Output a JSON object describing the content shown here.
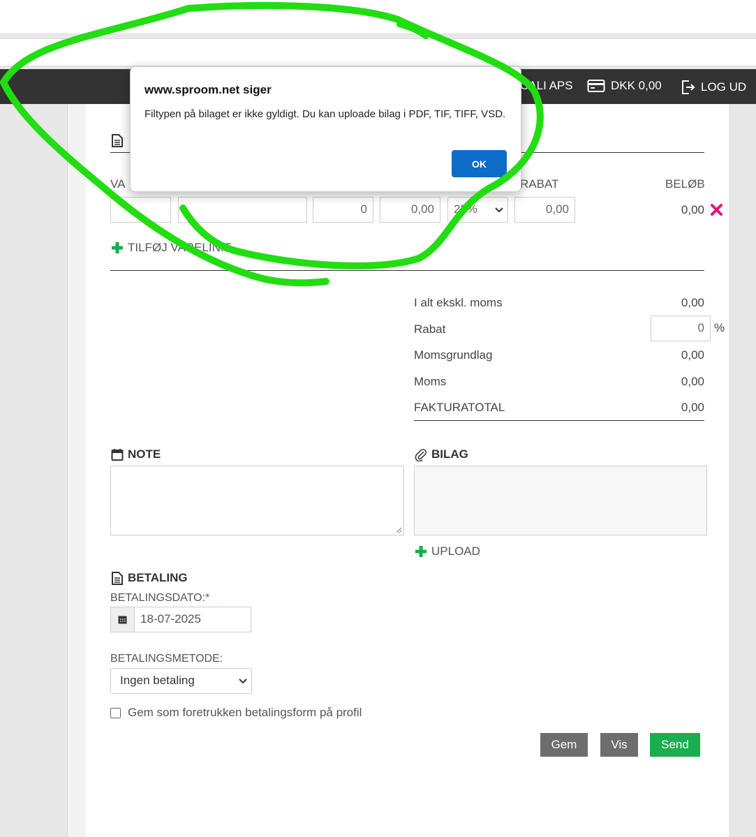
{
  "topnav": {
    "company": "CALI APS",
    "balance": "DKK 0,00",
    "logout": "LOG UD"
  },
  "lines": {
    "col_rabat": "RABAT",
    "col_belob": "BELØB",
    "col_first_partial": "VA",
    "qty": "0",
    "price": "0,00",
    "vat_selected": "25%",
    "discount": "0,00",
    "amount": "0,00",
    "add_line": "TILFØJ VARELINIE"
  },
  "totals": {
    "excl_label": "I alt ekskl. moms",
    "excl_value": "0,00",
    "discount_label": "Rabat",
    "discount_value": "0",
    "discount_unit": "%",
    "base_label": "Momsgrundlag",
    "base_value": "0,00",
    "vat_label": "Moms",
    "vat_value": "0,00",
    "total_label": "FAKTURATOTAL",
    "total_value": "0,00"
  },
  "note": {
    "title": "NOTE",
    "text": ""
  },
  "attachment": {
    "title": "BILAG",
    "upload": "UPLOAD"
  },
  "payment": {
    "title": "BETALING",
    "date_label": "BETALINGSDATO:",
    "required_mark": "*",
    "date_value": "18-07-2025",
    "method_label": "BETALINGSMETODE:",
    "method_value": "Ingen betaling",
    "save_pref_label": "Gem som foretrukken betalingsform på profil"
  },
  "actions": {
    "save": "Gem",
    "preview": "Vis",
    "send": "Send"
  },
  "dialog": {
    "title": "www.sproom.net siger",
    "message": "Filtypen på bilaget er ikke gyldigt. Du kan uploade bilag i PDF, TIF, TIFF, VSD.",
    "ok": "OK"
  },
  "colors": {
    "accent_green": "#1aae4e",
    "dialog_button": "#0b6dc7",
    "delete_icon": "#e8107a",
    "scribble": "#22dd11"
  }
}
